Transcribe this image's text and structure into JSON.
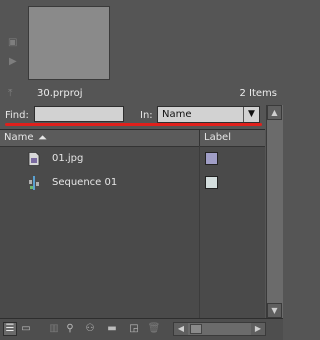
{
  "project": {
    "name": "30.prproj",
    "item_count": "2 Items"
  },
  "find": {
    "label": "Find:",
    "value": ""
  },
  "in_filter": {
    "label": "In:",
    "value": "Name"
  },
  "columns": {
    "name": "Name",
    "label": "Label"
  },
  "items": [
    {
      "name": "01.jpg",
      "icon": "image-file-icon",
      "label_color": "#a09ec6"
    },
    {
      "name": "Sequence 01",
      "icon": "sequence-icon",
      "label_color": "#d4dede"
    }
  ],
  "annotation": {
    "underline_color": "#e0201c"
  }
}
